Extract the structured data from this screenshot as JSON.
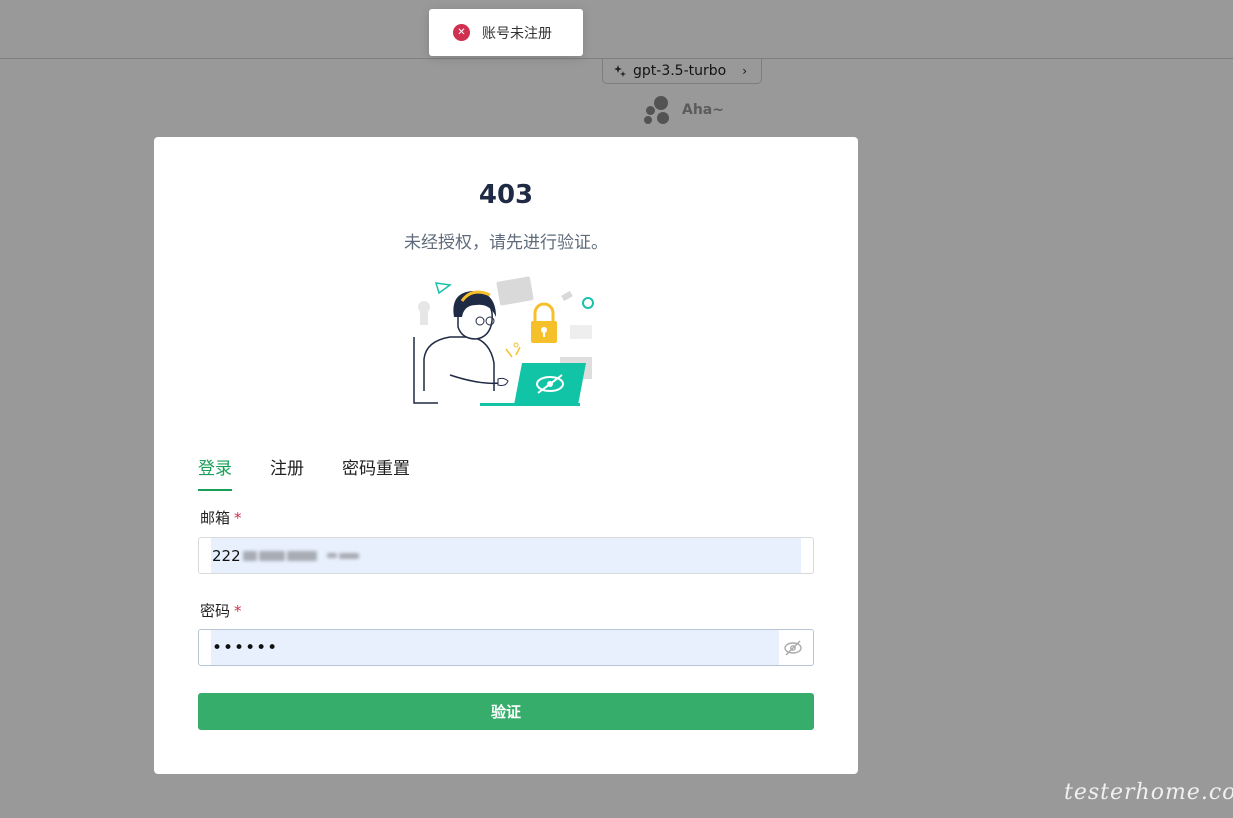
{
  "background": {
    "model_chip": {
      "label": "gpt-3.5-turbo"
    },
    "assistant_name": "Aha~"
  },
  "toast": {
    "message": "账号未注册",
    "type": "error"
  },
  "modal": {
    "code": "403",
    "description": "未经授权，请先进行验证。",
    "tabs": [
      {
        "label": "登录",
        "active": true
      },
      {
        "label": "注册",
        "active": false
      },
      {
        "label": "密码重置",
        "active": false
      }
    ],
    "email": {
      "label": "邮箱",
      "required_mark": "*",
      "value_visible_prefix": "222"
    },
    "password": {
      "label": "密码",
      "required_mark": "*",
      "masked_value": "••••••"
    },
    "submit_label": "验证"
  },
  "colors": {
    "primary": "#18a058",
    "button": "#36ad6a",
    "error": "#d03050",
    "autofill": "#e8f0fe"
  },
  "watermark": "testerhome.com"
}
